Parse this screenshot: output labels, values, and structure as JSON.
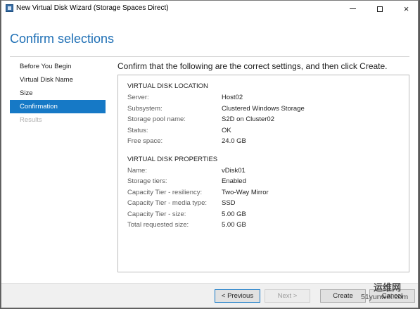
{
  "window": {
    "title": "New Virtual Disk Wizard (Storage Spaces Direct)",
    "minimize_glyph": "minimize",
    "maximize_glyph": "maximize",
    "close_glyph": "×"
  },
  "header": {
    "title": "Confirm selections"
  },
  "nav": {
    "items": [
      {
        "label": "Before You Begin",
        "state": "normal"
      },
      {
        "label": "Virtual Disk Name",
        "state": "normal"
      },
      {
        "label": "Size",
        "state": "normal"
      },
      {
        "label": "Confirmation",
        "state": "active"
      },
      {
        "label": "Results",
        "state": "disabled"
      }
    ]
  },
  "content": {
    "heading": "Confirm that the following are the correct settings, and then click Create.",
    "location": {
      "title": "VIRTUAL DISK LOCATION",
      "rows": [
        {
          "label": "Server:",
          "value": "Host02"
        },
        {
          "label": "Subsystem:",
          "value": "Clustered Windows Storage"
        },
        {
          "label": "Storage pool name:",
          "value": "S2D on Cluster02"
        },
        {
          "label": "Status:",
          "value": "OK"
        },
        {
          "label": "Free space:",
          "value": "24.0 GB"
        }
      ]
    },
    "properties": {
      "title": "VIRTUAL DISK PROPERTIES",
      "rows": [
        {
          "label": "Name:",
          "value": "vDisk01"
        },
        {
          "label": "Storage tiers:",
          "value": "Enabled"
        },
        {
          "label": "Capacity Tier - resiliency:",
          "value": "Two-Way Mirror"
        },
        {
          "label": "Capacity Tier - media type:",
          "value": "SSD"
        },
        {
          "label": "Capacity Tier - size:",
          "value": "5.00 GB"
        },
        {
          "label": "Total requested size:",
          "value": "5.00 GB"
        }
      ]
    }
  },
  "footer": {
    "previous_label": "< Previous",
    "next_label": "Next >",
    "create_label": "Create",
    "cancel_label": "Cancel"
  },
  "watermark": {
    "site": "运维网",
    "url": "51yunwei.com"
  },
  "colors": {
    "accent": "#1679c6",
    "title_blue": "#1e6fb5",
    "footer_bg": "#f0f0f0"
  }
}
